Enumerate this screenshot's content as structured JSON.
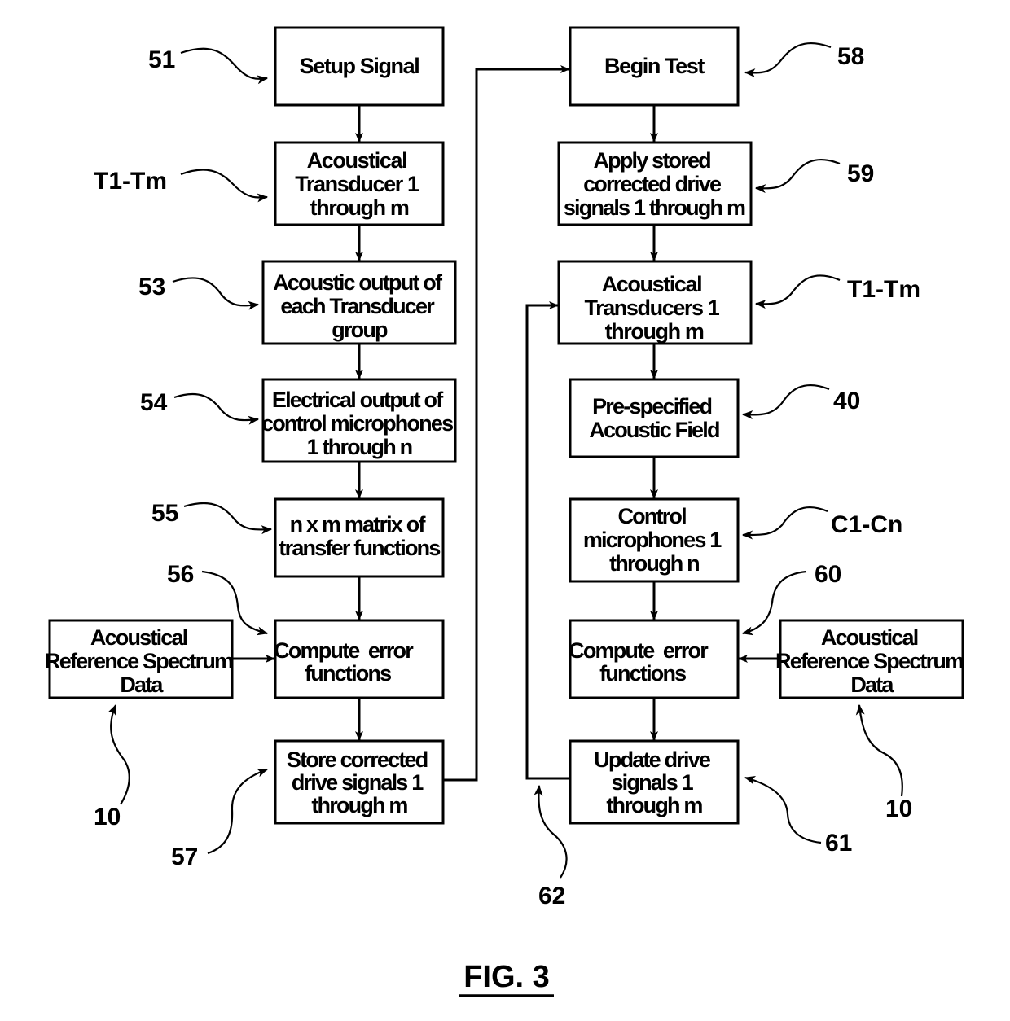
{
  "figure": {
    "title": "FIG. 3"
  },
  "left_column": {
    "boxes": [
      {
        "id": "setup-signal",
        "lines": [
          "Setup Signal"
        ]
      },
      {
        "id": "acoustical-transducer",
        "lines": [
          "Acoustical",
          "Transducer 1",
          "through m"
        ]
      },
      {
        "id": "acoustic-output",
        "lines": [
          "Acoustic output of",
          "each Transducer",
          "group"
        ]
      },
      {
        "id": "electrical-output",
        "lines": [
          "Electrical output of",
          "control microphones",
          "1 through n"
        ]
      },
      {
        "id": "transfer-matrix",
        "lines": [
          "n x m matrix of",
          "transfer functions"
        ]
      },
      {
        "id": "compute-error-left",
        "lines": [
          "Compute  error",
          "functions"
        ]
      },
      {
        "id": "store-corrected",
        "lines": [
          "Store corrected",
          "drive signals 1",
          "through m"
        ]
      },
      {
        "id": "reference-spectrum-left",
        "lines": [
          "Acoustical",
          "Reference Spectrum",
          "Data"
        ]
      }
    ],
    "labels": [
      "51",
      "T1-Tm",
      "53",
      "54",
      "55",
      "56",
      "57",
      "10"
    ]
  },
  "right_column": {
    "boxes": [
      {
        "id": "begin-test",
        "lines": [
          "Begin Test"
        ]
      },
      {
        "id": "apply-stored",
        "lines": [
          "Apply stored",
          "corrected drive",
          "signals 1 through m"
        ]
      },
      {
        "id": "acoustical-transducers",
        "lines": [
          "Acoustical",
          "Transducers 1",
          "through m"
        ]
      },
      {
        "id": "prespecified-field",
        "lines": [
          "Pre-specified",
          "Acoustic Field"
        ]
      },
      {
        "id": "control-microphones",
        "lines": [
          "Control",
          "microphones 1",
          "through n"
        ]
      },
      {
        "id": "compute-error-right",
        "lines": [
          "Compute  error",
          "functions"
        ]
      },
      {
        "id": "update-drive",
        "lines": [
          "Update drive",
          "signals 1",
          "through m"
        ]
      },
      {
        "id": "reference-spectrum-right",
        "lines": [
          "Acoustical",
          "Reference Spectrum",
          "Data"
        ]
      }
    ],
    "labels": [
      "58",
      "59",
      "T1-Tm",
      "40",
      "C1-Cn",
      "60",
      "61",
      "10",
      "62"
    ]
  }
}
